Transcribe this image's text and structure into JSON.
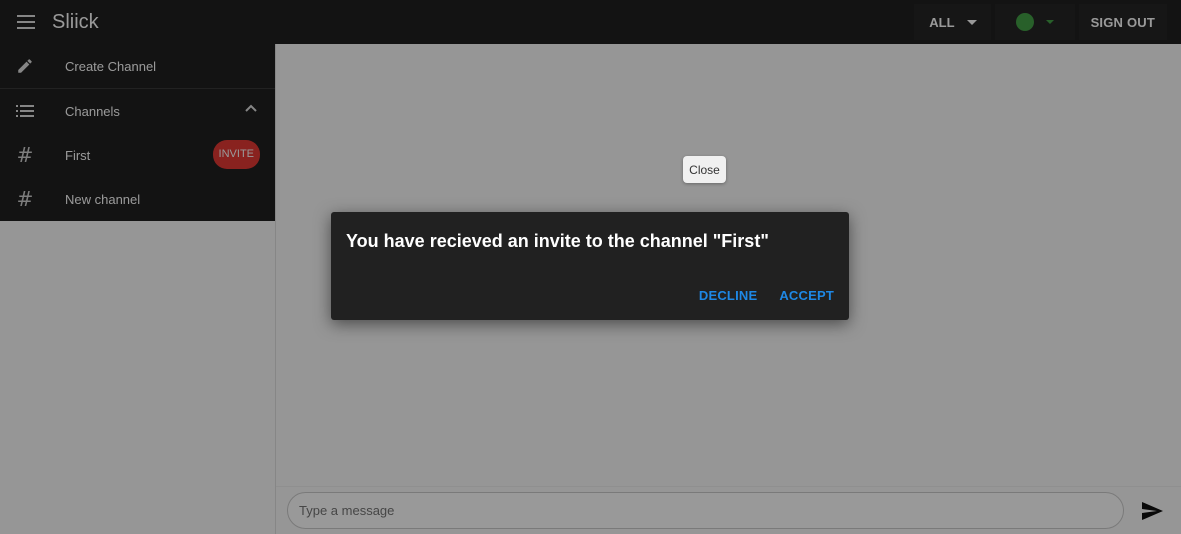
{
  "app": {
    "title": "Sliick"
  },
  "header": {
    "filter_label": "ALL",
    "status_color": "#43a047",
    "signout_label": "SIGN OUT"
  },
  "sidebar": {
    "create_channel_label": "Create Channel",
    "channels_header_label": "Channels",
    "channels": [
      {
        "name": "First",
        "badge": "INVITE"
      },
      {
        "name": "New channel",
        "badge": ""
      }
    ]
  },
  "composer": {
    "placeholder": "Type a message"
  },
  "tooltip": {
    "text": "Close"
  },
  "dialog": {
    "message": "You have recieved an invite to the channel \"First\"",
    "decline_label": "DECLINE",
    "accept_label": "ACCEPT"
  },
  "colors": {
    "accent": "#1e88e5",
    "badge": "#e53935",
    "bar": "#212121"
  }
}
